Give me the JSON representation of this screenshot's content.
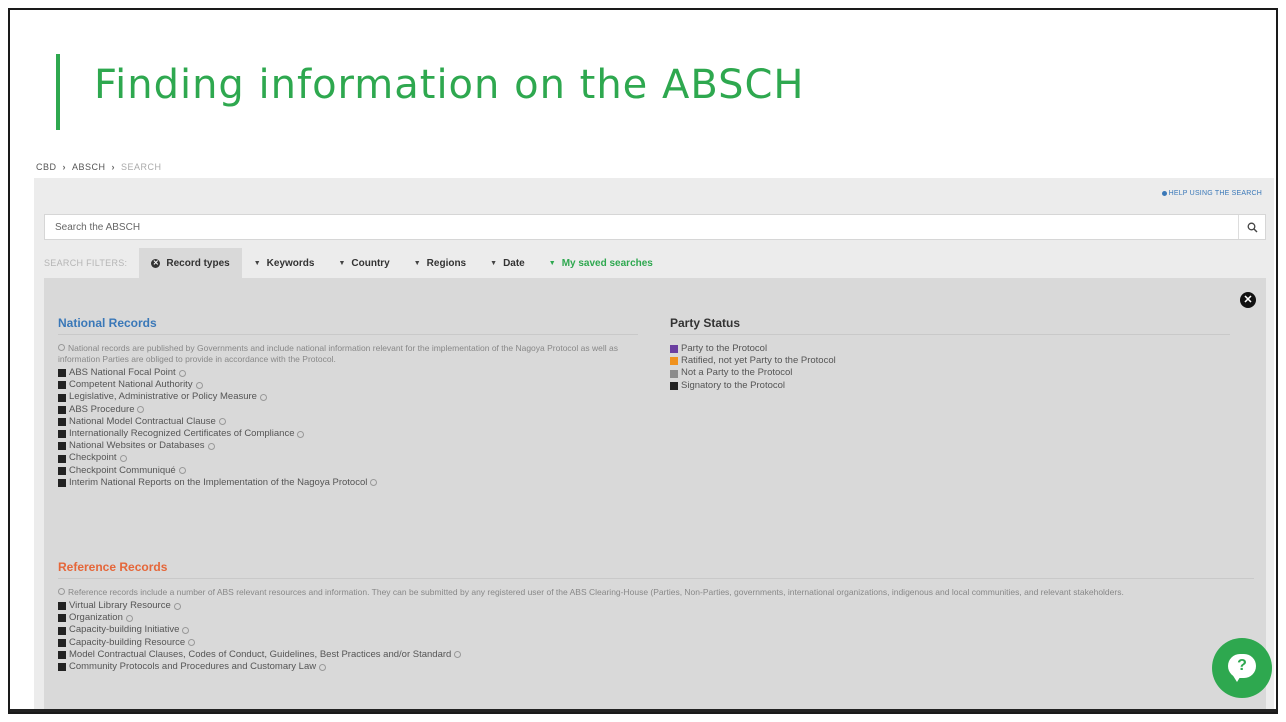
{
  "slide": {
    "title": "Finding information on the ABSCH"
  },
  "breadcrumb": {
    "items": [
      "CBD",
      "ABSCH",
      "SEARCH"
    ]
  },
  "toolbar": {
    "help_link": "HELP USING THE SEARCH"
  },
  "search": {
    "placeholder": "Search the ABSCH"
  },
  "filters": {
    "label": "SEARCH FILTERS:",
    "tabs": [
      {
        "label": "Record types",
        "state": "active"
      },
      {
        "label": "Keywords"
      },
      {
        "label": "Country"
      },
      {
        "label": "Regions"
      },
      {
        "label": "Date"
      },
      {
        "label": "My saved searches",
        "color": "#2ea84f"
      }
    ]
  },
  "national": {
    "title": "National Records",
    "description": "National records are published by Governments and include national information relevant for the implementation of the Nagoya Protocol as well as information Parties are obliged to provide in accordance with the Protocol.",
    "items": [
      "ABS National Focal Point",
      "Competent National Authority",
      "Legislative, Administrative or Policy Measure",
      "ABS Procedure",
      "National Model Contractual Clause",
      "Internationally Recognized Certificates of Compliance",
      "National Websites or Databases",
      "Checkpoint",
      "Checkpoint Communiqué",
      "Interim National Reports on the Implementation of the Nagoya Protocol"
    ]
  },
  "party_status": {
    "title": "Party Status",
    "items": [
      {
        "label": "Party to the Protocol",
        "color": "#6b3fa0"
      },
      {
        "label": "Ratified, not yet Party to the Protocol",
        "color": "#f0921e"
      },
      {
        "label": "Not a Party to the Protocol",
        "color": "#8c8c8c"
      },
      {
        "label": "Signatory to the Protocol",
        "color": "#222222"
      }
    ]
  },
  "reference": {
    "title": "Reference Records",
    "description": "Reference records include a number of ABS relevant resources and information. They can be submitted by any registered user of the ABS Clearing-House (Parties, Non-Parties, governments, international organizations, indigenous and local communities, and relevant stakeholders.",
    "items": [
      "Virtual Library Resource",
      "Organization",
      "Capacity-building Initiative",
      "Capacity-building Resource",
      "Model Contractual Clauses, Codes of Conduct, Guidelines, Best Practices and/or Standard",
      "Community Protocols and Procedures and Customary Law"
    ]
  },
  "help_widget": {
    "label": "?"
  },
  "colors": {
    "accent_green": "#2ea84f",
    "link_blue": "#3a78b8",
    "reference_orange": "#e5673a"
  }
}
